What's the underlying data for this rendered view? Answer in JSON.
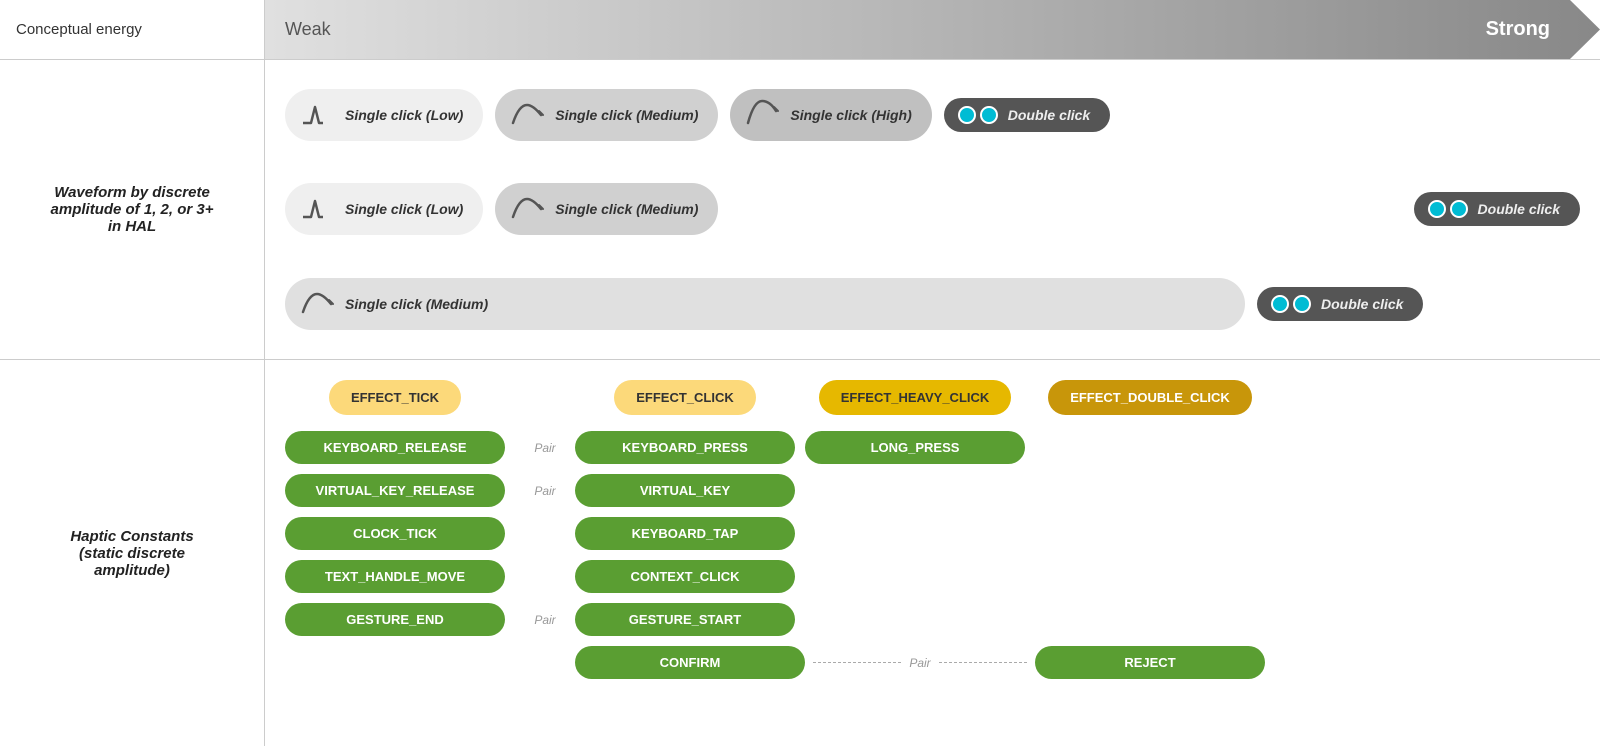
{
  "header": {
    "left_label": "Conceptual energy",
    "energy_weak": "Weak",
    "energy_strong": "Strong"
  },
  "waveform_section": {
    "left_label": "Waveform by discrete\namplitude of 1, 2, or 3+\nin HAL",
    "rows": [
      {
        "pills": [
          {
            "type": "low",
            "label": "Single click (Low)"
          },
          {
            "type": "medium",
            "label": "Single click (Medium)"
          },
          {
            "type": "high",
            "label": "Single click (High)"
          },
          {
            "type": "double",
            "label": "Double click"
          }
        ]
      },
      {
        "pills": [
          {
            "type": "low",
            "label": "Single click (Low)"
          },
          {
            "type": "medium",
            "label": "Single click (Medium)"
          },
          {
            "type": "double",
            "label": "Double click"
          }
        ]
      },
      {
        "pills": [
          {
            "type": "medium",
            "label": "Single click (Medium)"
          },
          {
            "type": "double",
            "label": "Double click"
          }
        ]
      }
    ]
  },
  "haptic_section": {
    "left_label": "Haptic Constants\n(static discrete\namplitude)",
    "effect_labels": [
      {
        "id": "effect_tick",
        "label": "EFFECT_TICK",
        "style": "light"
      },
      {
        "id": "effect_click",
        "label": "EFFECT_CLICK",
        "style": "light"
      },
      {
        "id": "effect_heavy",
        "label": "EFFECT_HEAVY_CLICK",
        "style": "medium"
      },
      {
        "id": "effect_double",
        "label": "EFFECT_DOUBLE_CLICK",
        "style": "dark"
      }
    ],
    "rows": [
      {
        "col_tick": "KEYBOARD_RELEASE",
        "has_pair": true,
        "pair_label": "Pair",
        "col_click": "KEYBOARD_PRESS",
        "col_heavy": "LONG_PRESS",
        "col_double": ""
      },
      {
        "col_tick": "VIRTUAL_KEY_RELEASE",
        "has_pair": true,
        "pair_label": "Pair",
        "col_click": "VIRTUAL_KEY",
        "col_heavy": "",
        "col_double": ""
      },
      {
        "col_tick": "CLOCK_TICK",
        "has_pair": false,
        "pair_label": "",
        "col_click": "KEYBOARD_TAP",
        "col_heavy": "",
        "col_double": ""
      },
      {
        "col_tick": "TEXT_HANDLE_MOVE",
        "has_pair": false,
        "pair_label": "",
        "col_click": "CONTEXT_CLICK",
        "col_heavy": "",
        "col_double": ""
      },
      {
        "col_tick": "GESTURE_END",
        "has_pair": true,
        "pair_label": "Pair",
        "col_click": "GESTURE_START",
        "col_heavy": "",
        "col_double": ""
      }
    ],
    "confirm_row": {
      "col_click": "CONFIRM",
      "pair_label": "Pair",
      "col_double": "REJECT"
    }
  },
  "colors": {
    "green_btn": "#5a9e32",
    "effect_tick_bg": "#fcd97a",
    "effect_heavy_bg": "#e6b800",
    "effect_double_bg": "#c8960a",
    "dark_pill_bg": "#555555",
    "medium_pill_bg": "#d0d0d0",
    "light_pill_bg": "#eeeeee"
  }
}
